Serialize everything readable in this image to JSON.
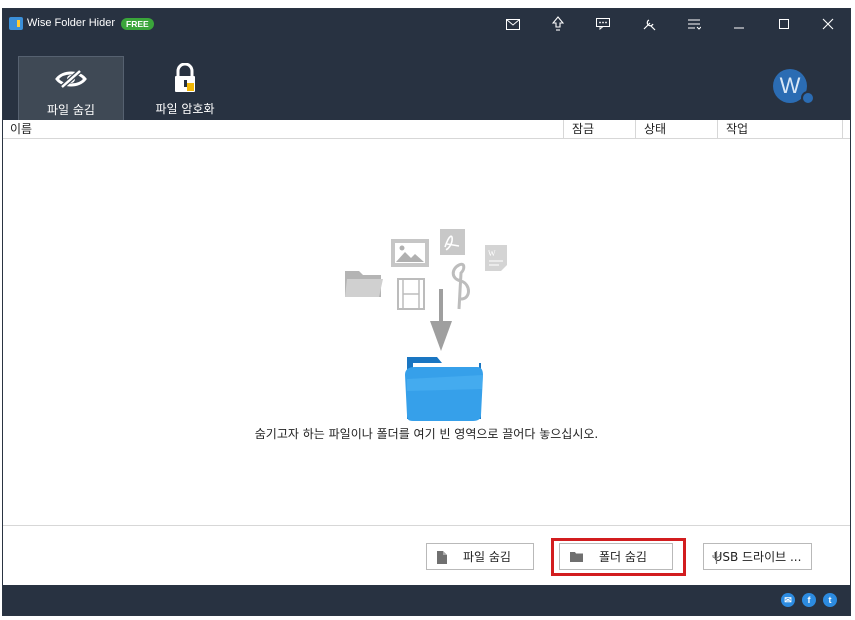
{
  "window": {
    "title": "Wise Folder Hider",
    "badge": "FREE"
  },
  "titlebar_icons": [
    "mail-icon",
    "upgrade-icon",
    "feedback-icon",
    "tools-icon",
    "menu-icon",
    "minimize-icon",
    "maximize-icon",
    "close-icon"
  ],
  "toolbar": {
    "tabs": [
      {
        "label": "파일 숨김",
        "icon": "hidden-eye-icon",
        "active": true
      },
      {
        "label": "파일 암호화",
        "icon": "padlock-icon",
        "active": false
      }
    ],
    "avatar_letter": "W"
  },
  "columns": {
    "name": "이름",
    "lock": "잠금",
    "status": "상태",
    "action": "작업"
  },
  "empty_state": {
    "hint": "숨기고자 하는 파일이나 폴더를 여기 빈 영역으로 끌어다 놓으십시오."
  },
  "buttons": {
    "hide_file": "파일 숨김",
    "hide_folder": "폴더 숨김",
    "usb_drive": "USB 드라이브 ..."
  },
  "social": [
    "mail-icon",
    "facebook-icon",
    "twitter-icon"
  ],
  "colors": {
    "chrome": "#283241",
    "highlight": "#d21d1f",
    "free_badge": "#3aa53a",
    "accent": "#2b6cb3"
  }
}
